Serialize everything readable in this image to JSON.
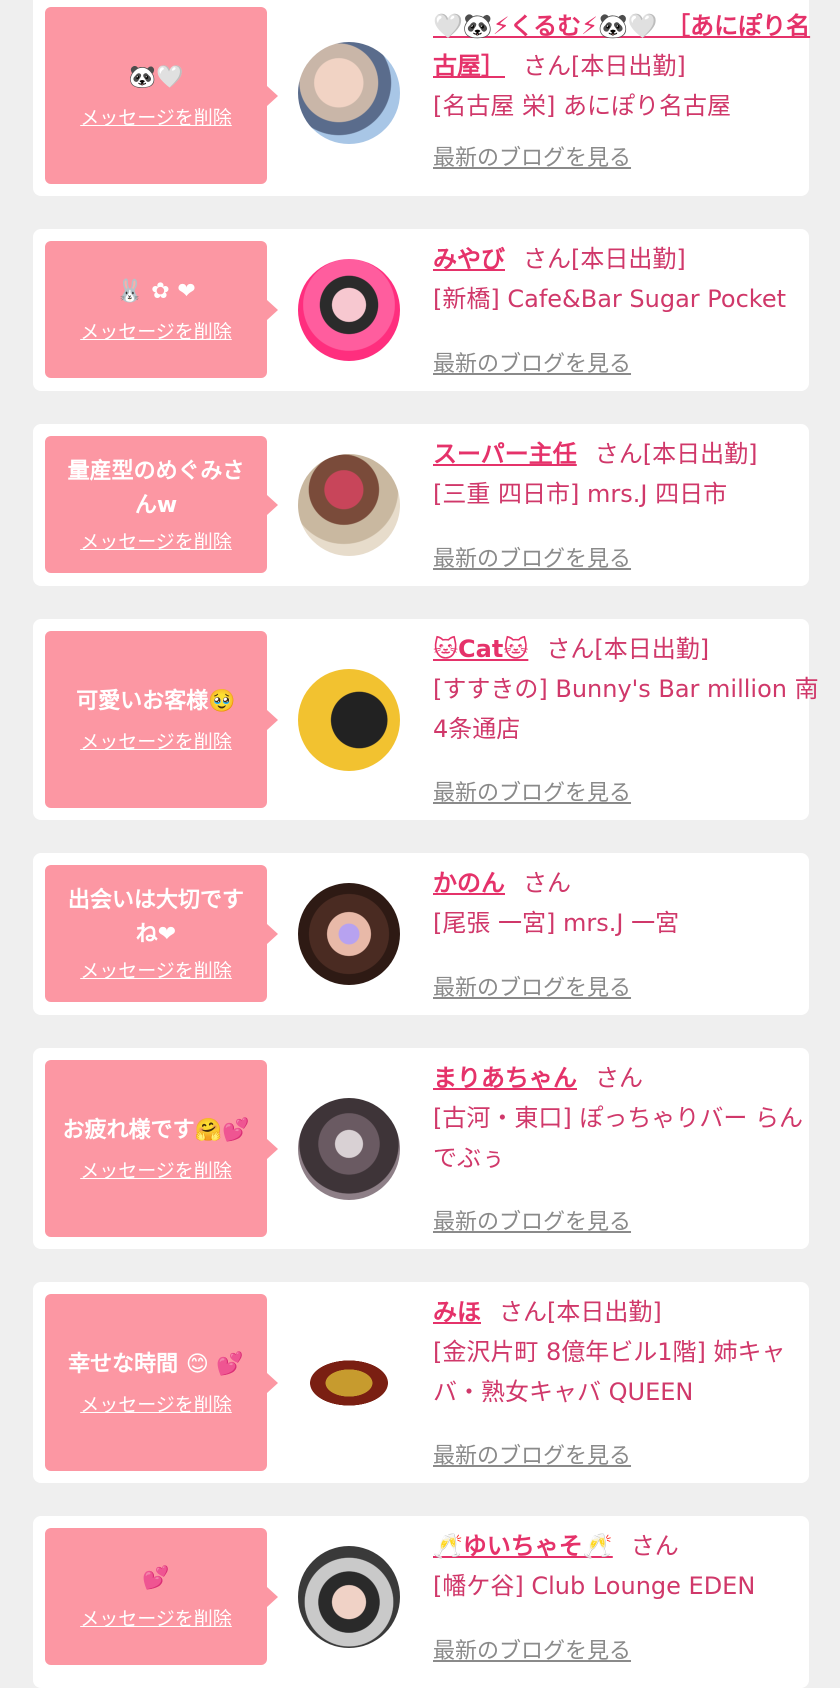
{
  "delete_label": "メッセージを削除",
  "blog_label": "最新のブログを見る",
  "colors": {
    "accent": "#e5326a",
    "bubble": "#fc97a3",
    "background": "#efefef"
  },
  "cards": [
    {
      "message": "🐼🤍",
      "name": "🤍🐼⚡くるむ⚡🐼🤍 ［あにぽり名古屋］",
      "suffix": "さん[本日出勤]",
      "shop": "[名古屋 栄] あにぽり名古屋"
    },
    {
      "message": "🐰 ✿ ❤",
      "name": "みやび",
      "suffix": "さん[本日出勤]",
      "shop": "[新橋] Cafe&Bar Sugar Pocket"
    },
    {
      "message": "量産型のめぐみさんw",
      "name": "スーパー主任",
      "suffix": "さん[本日出勤]",
      "shop": "[三重 四日市] mrs.J 四日市"
    },
    {
      "message": "可愛いお客様🥹",
      "name": "🐱Cat🐱",
      "suffix": "さん[本日出勤]",
      "shop": "[すすきの] Bunny's Bar million 南4条通店"
    },
    {
      "message": "出会いは大切ですね❤",
      "name": "かのん",
      "suffix": "さん",
      "shop": "[尾張 一宮] mrs.J 一宮"
    },
    {
      "message": "お疲れ様です🤗💕",
      "name": "まりあちゃん",
      "suffix": "さん",
      "shop": "[古河・東口] ぽっちゃりバー らんでぶぅ"
    },
    {
      "message": "幸せな時間 😊 💕",
      "name": "みほ",
      "suffix": "さん[本日出勤]",
      "shop": "[金沢片町 8億年ビル1階] 姉キャバ・熟女キャバ QUEEN"
    },
    {
      "message": "💕",
      "name": "🥂ゆいちゃそ🥂",
      "suffix": "さん",
      "shop": "[幡ケ谷] Club Lounge EDEN"
    }
  ]
}
